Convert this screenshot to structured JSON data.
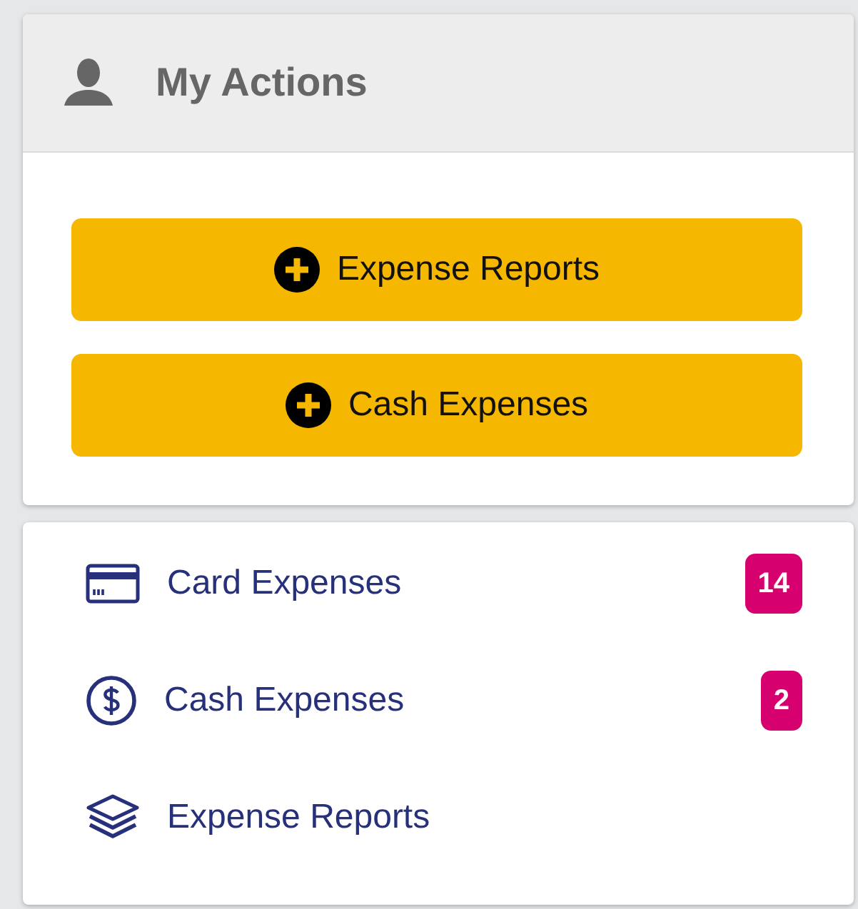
{
  "panel": {
    "title": "My Actions"
  },
  "actions": [
    {
      "label": "Expense Reports"
    },
    {
      "label": "Cash Expenses"
    }
  ],
  "nav_items": [
    {
      "label": "Card Expenses",
      "kind": "card",
      "badge": "14"
    },
    {
      "label": "Cash Expenses",
      "kind": "cash",
      "badge": "2"
    },
    {
      "label": "Expense Reports",
      "kind": "report"
    }
  ]
}
